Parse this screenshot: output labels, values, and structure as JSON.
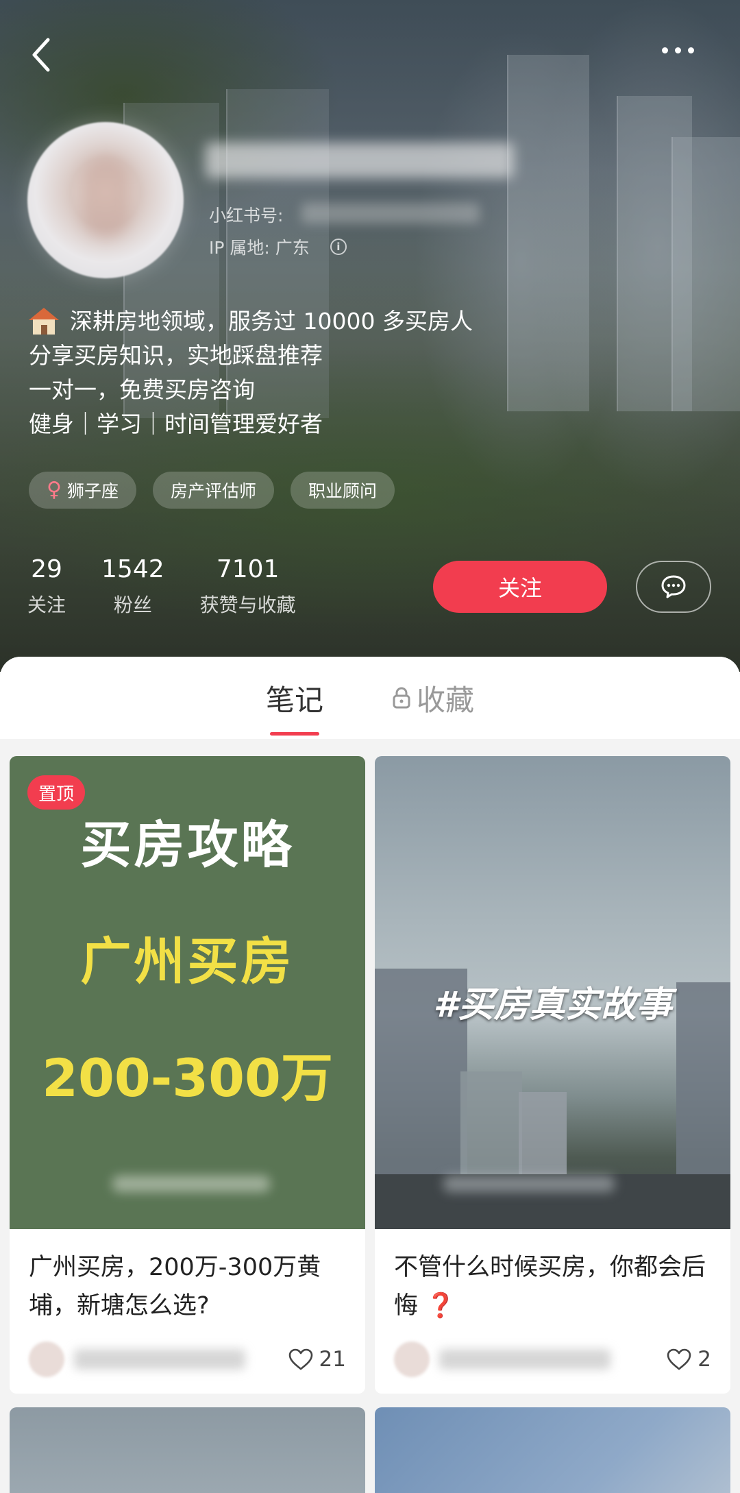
{
  "profile": {
    "red_id_label": "小红书号:",
    "ip_label": "IP 属地: 广东",
    "bio_lines": [
      "深耕房地领域，服务过 10000 多买房人",
      "分享买房知识，实地踩盘推荐",
      "一对一，免费买房咨询",
      "健身｜学习｜时间管理爱好者"
    ],
    "tags": [
      "狮子座",
      "房产评估师",
      "职业顾问"
    ],
    "stats": [
      {
        "value": "29",
        "label": "关注"
      },
      {
        "value": "1542",
        "label": "粉丝"
      },
      {
        "value": "7101",
        "label": "获赞与收藏"
      }
    ],
    "follow_label": "关注"
  },
  "tabs": [
    {
      "label": "笔记",
      "active": true
    },
    {
      "label": "收藏",
      "active": false,
      "locked": true
    }
  ],
  "notes": [
    {
      "pin_label": "置顶",
      "cover_lines": [
        "买房攻略",
        "广州买房",
        "200-300万"
      ],
      "title": "广州买房，200万-300万黄埔，新塘怎么选?",
      "likes": "21"
    },
    {
      "cover_text": "#买房真实故事",
      "title": "不管什么时候买房，你都会后悔",
      "title_icon": "❓",
      "likes": "2"
    }
  ],
  "colors": {
    "accent": "#f23d4f",
    "cover_green": "#5a7554",
    "cover_yellow": "#f2e046"
  },
  "icons": [
    "back-arrow-icon",
    "more-dots-icon",
    "info-icon",
    "house-icon",
    "female-icon",
    "chat-bubble-icon",
    "lock-icon",
    "heart-icon",
    "question-icon"
  ]
}
